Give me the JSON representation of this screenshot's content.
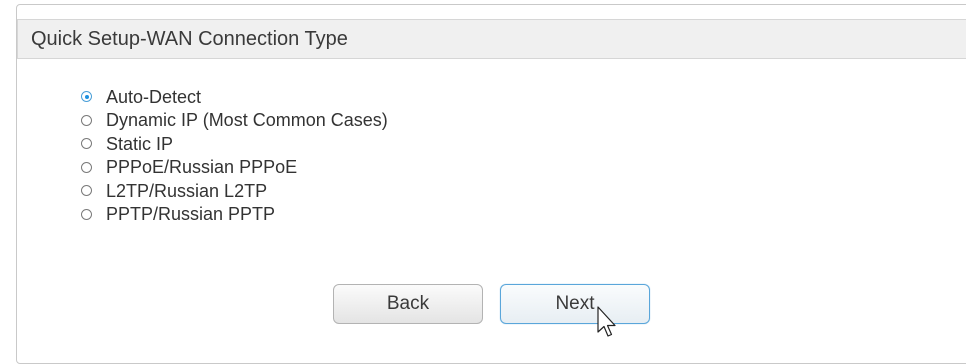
{
  "panel": {
    "title": "Quick Setup-WAN Connection Type"
  },
  "wan_types": {
    "selected": "Auto-Detect",
    "options": [
      {
        "label": "Auto-Detect",
        "checked": true
      },
      {
        "label": "Dynamic IP (Most Common Cases)",
        "checked": false
      },
      {
        "label": "Static IP",
        "checked": false
      },
      {
        "label": "PPPoE/Russian PPPoE",
        "checked": false
      },
      {
        "label": "L2TP/Russian L2TP",
        "checked": false
      },
      {
        "label": "PPTP/Russian PPTP",
        "checked": false
      }
    ]
  },
  "buttons": {
    "back_label": "Back",
    "next_label": "Next"
  },
  "icons": {
    "cursor": "mouse-pointer-icon"
  },
  "colors": {
    "accent": "#1e90e0",
    "header_bg": "#f0f0f0",
    "next_border": "#5aa6da"
  }
}
